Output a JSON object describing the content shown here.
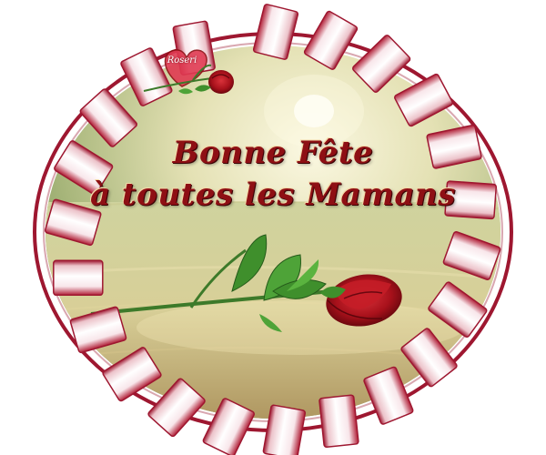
{
  "greeting": {
    "line1": "Bonne Fête",
    "line2": "à toutes les Mamans"
  },
  "signature": "Roseri",
  "colors": {
    "frame_ribbon": "#f6e1e4",
    "frame_shadow": "#a81d33",
    "sea_light": "#f3efcc",
    "sea_green": "#8fa95a",
    "sand": "#b8a06a",
    "text": "#8e0f14",
    "rose": "#b0121c",
    "leaf": "#3f8f2c"
  }
}
